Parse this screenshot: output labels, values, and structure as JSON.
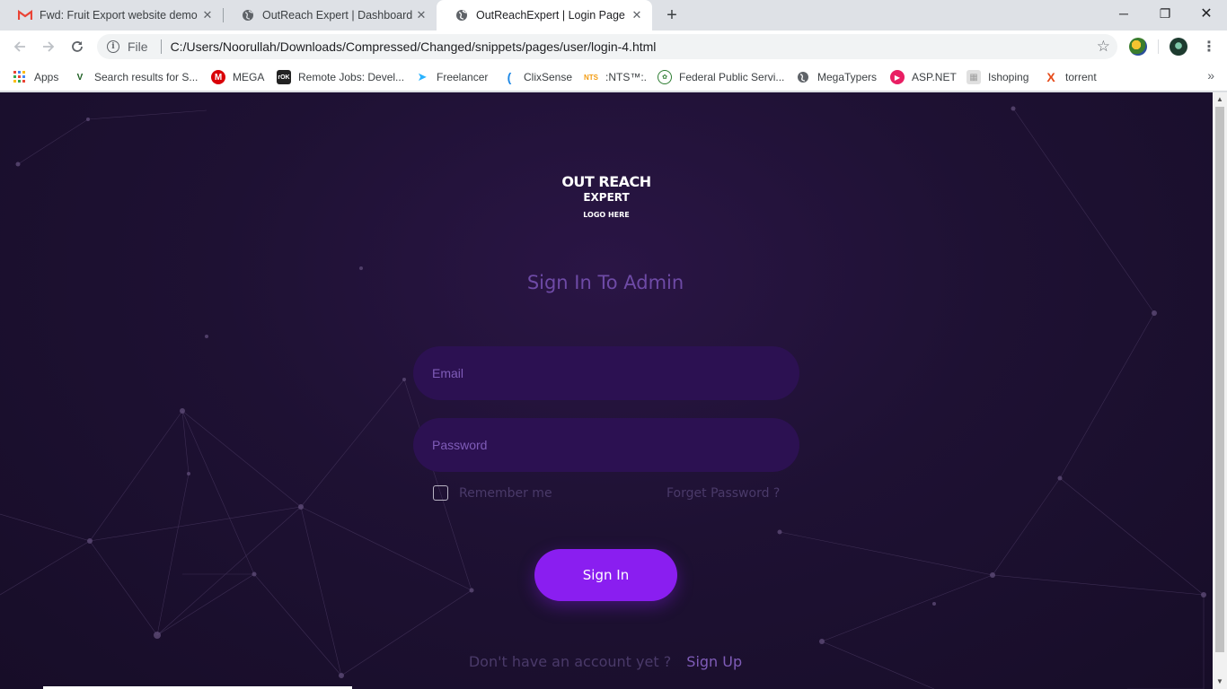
{
  "browser": {
    "tabs": [
      {
        "title": "Fwd: Fruit Export website demo",
        "favicon": "gmail-icon"
      },
      {
        "title": "OutReach Expert | Dashboard",
        "favicon": "globe-icon"
      },
      {
        "title": "OutReachExpert | Login Page",
        "favicon": "globe-icon"
      }
    ],
    "address": {
      "scheme": "File",
      "url": "C:/Users/Noorullah/Downloads/Compressed/Changed/snippets/pages/user/login-4.html"
    },
    "bookmarks": [
      {
        "label": "Apps",
        "icon": "apps-grid-icon",
        "color": "#ea4335"
      },
      {
        "label": "Search results for S...",
        "icon": "v-logo-icon",
        "color": "#1b5e20"
      },
      {
        "label": "MEGA",
        "icon": "mega-icon",
        "color": "#d90007"
      },
      {
        "label": "Remote Jobs: Devel...",
        "icon": "remote-jobs-icon",
        "color": "#222222"
      },
      {
        "label": "Freelancer",
        "icon": "freelancer-icon",
        "color": "#29b2fe"
      },
      {
        "label": "ClixSense",
        "icon": "clixsense-icon",
        "color": "#1e88e5"
      },
      {
        "label": ":NTS™:.",
        "icon": "nts-icon",
        "color": "#f39c12"
      },
      {
        "label": "Federal Public Servi...",
        "icon": "fpsc-icon",
        "color": "#2e7d32"
      },
      {
        "label": "MegaTypers",
        "icon": "globe-icon",
        "color": "#5f6368"
      },
      {
        "label": "ASP.NET",
        "icon": "aspnet-icon",
        "color": "#e91e63"
      },
      {
        "label": "Ishoping",
        "icon": "ishoping-icon",
        "color": "#9e9e9e"
      },
      {
        "label": "torrent",
        "icon": "torrent-icon",
        "color": "#e64a19"
      }
    ]
  },
  "login": {
    "logo_line1": "OUT REACH",
    "logo_line2": "EXPERT",
    "logo_line3": "LOGO HERE",
    "heading": "Sign In To Admin",
    "email_placeholder": "Email",
    "password_placeholder": "Password",
    "remember_label": "Remember me",
    "forgot_label": "Forget Password ?",
    "signin_label": "Sign In",
    "no_account_text": "Don't have an account yet ?",
    "signup_label": "Sign Up"
  },
  "colors": {
    "accent": "#8a1ef0",
    "heading": "#6e4aa6",
    "input_bg": "#2c1152",
    "page_bg": "#1e1133"
  }
}
